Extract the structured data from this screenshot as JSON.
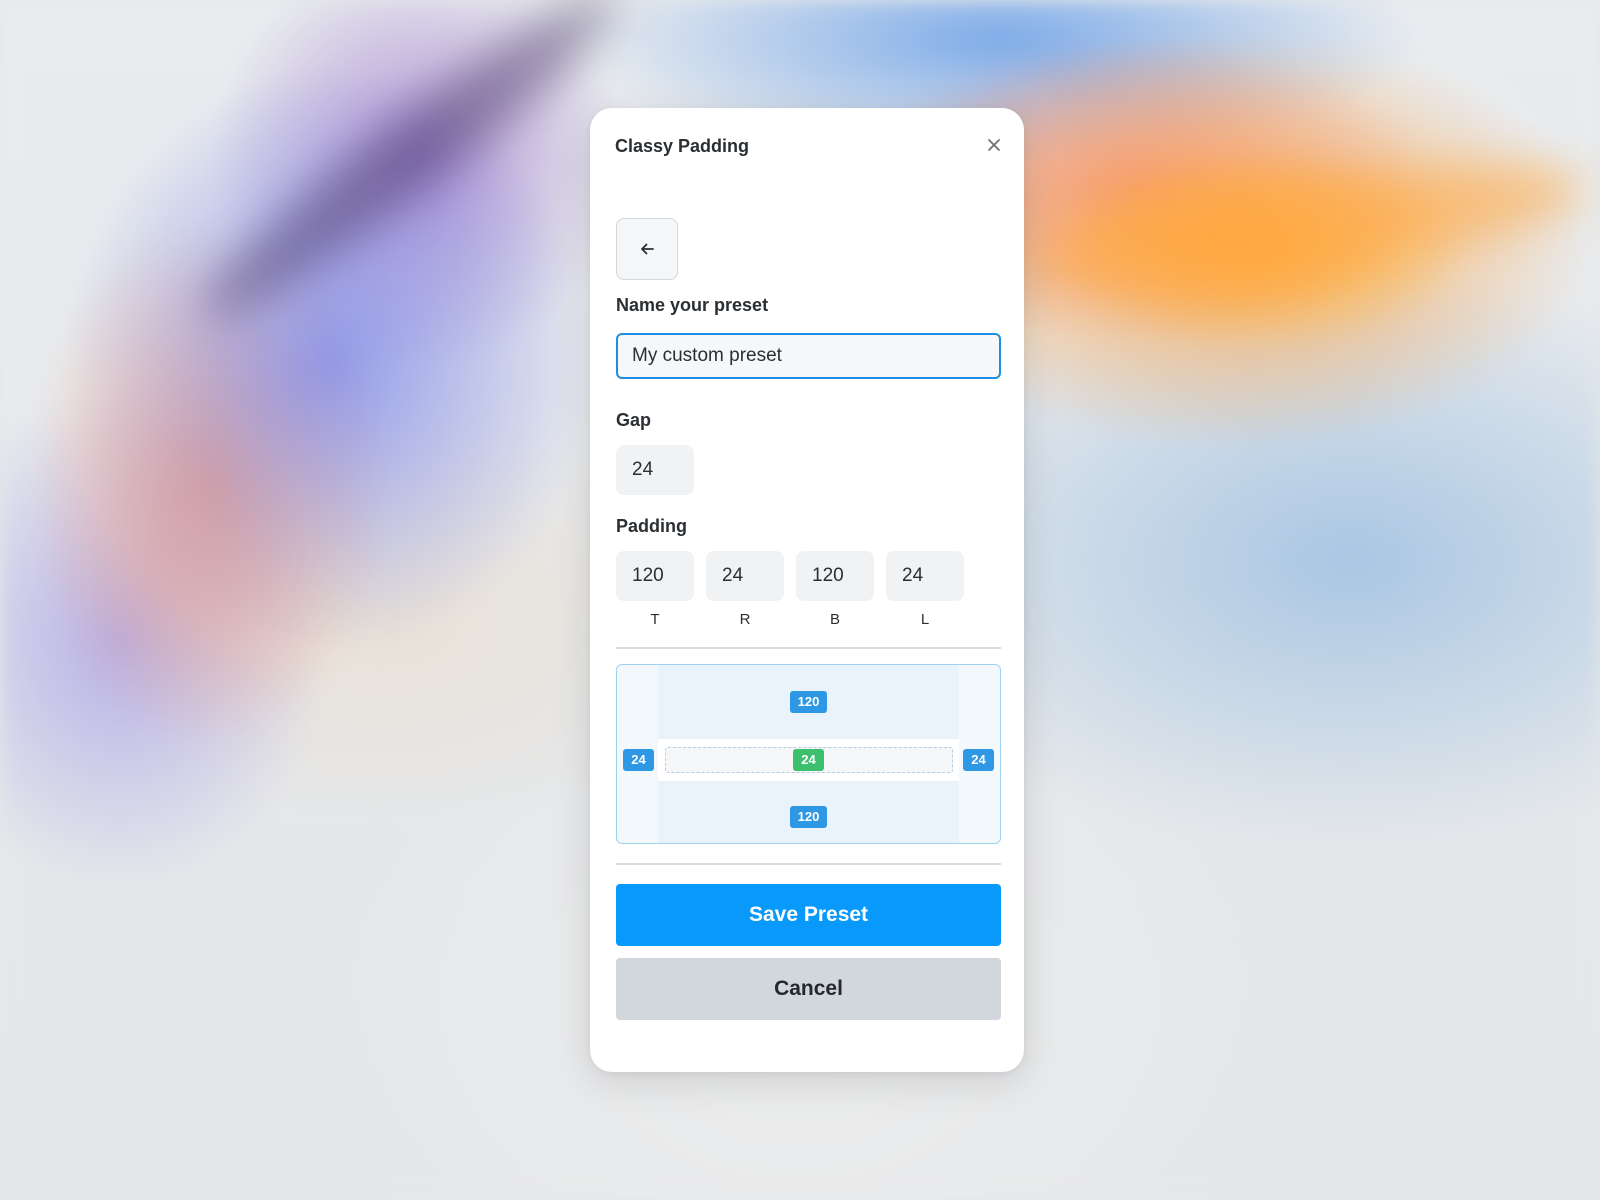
{
  "dialog": {
    "title": "Classy Padding"
  },
  "icons": {
    "close": "close-icon",
    "back": "arrow-left-icon"
  },
  "form": {
    "name_label": "Name your preset",
    "name_value": "My custom preset",
    "gap_label": "Gap",
    "gap_value": "24",
    "padding_label": "Padding",
    "padding": [
      {
        "side": "T",
        "value": "120"
      },
      {
        "side": "R",
        "value": "24"
      },
      {
        "side": "B",
        "value": "120"
      },
      {
        "side": "L",
        "value": "24"
      }
    ]
  },
  "preview": {
    "top": "120",
    "bottom": "120",
    "left": "24",
    "right": "24",
    "gap": "24"
  },
  "actions": {
    "save_label": "Save Preset",
    "cancel_label": "Cancel"
  },
  "colors": {
    "accent": "#0899fb",
    "focus_border": "#1e8fe0",
    "padding_tag": "#2f98e4",
    "gap_tag": "#3dbf6e",
    "cancel_bg": "#d2d7dd"
  }
}
